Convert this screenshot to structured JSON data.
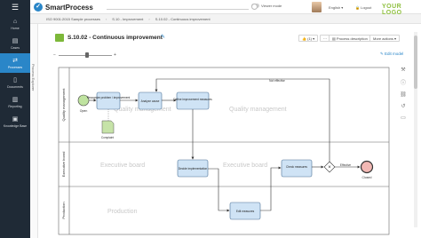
{
  "app": {
    "brand": "SmartProcess",
    "viewer_mode_label": "Viewer mode",
    "language": "English",
    "logout": "Logout",
    "your_logo": "YOUR LOGO",
    "brand_color": "#2a86c8",
    "accent_green": "#8fc03f"
  },
  "sidebar": {
    "items": [
      {
        "label": "Home",
        "icon": "home-icon"
      },
      {
        "label": "Cases",
        "icon": "briefcase-icon"
      },
      {
        "label": "Processes",
        "icon": "processes-icon",
        "active": true
      },
      {
        "label": "Documents",
        "icon": "document-icon"
      },
      {
        "label": "Reporting",
        "icon": "chart-icon"
      },
      {
        "label": "Knowledge Base",
        "icon": "book-icon"
      }
    ]
  },
  "breadcrumb": [
    "ISO 9001:2015 Sample processes",
    "S.10 - Improvement",
    "S.10.02 - Continuous improvement"
  ],
  "explorer_label": "Process Explorer",
  "header": {
    "title": "S.10.02 - Continuous improvement",
    "like_count": "(1)",
    "process_description": "Process description",
    "more_actions": "More actions"
  },
  "toolbar": {
    "edit_model": "Edit model"
  },
  "diagram": {
    "lanes": [
      "Quality management",
      "Executive board",
      "Production"
    ],
    "lane_watermarks": [
      "Quality management",
      "Quality management",
      "Executive board",
      "Executive board",
      "Production"
    ],
    "events": {
      "start": "Open",
      "end": "Closed"
    },
    "tasks": [
      "Recognize problem / improvement",
      "Analyze cause",
      "Define improvement measures",
      "Decide implementation",
      "Edit measures",
      "Check measures"
    ],
    "document": "Complaint",
    "gateway_labels": {
      "not_effective": "Not effective",
      "effective": "Effective"
    }
  }
}
